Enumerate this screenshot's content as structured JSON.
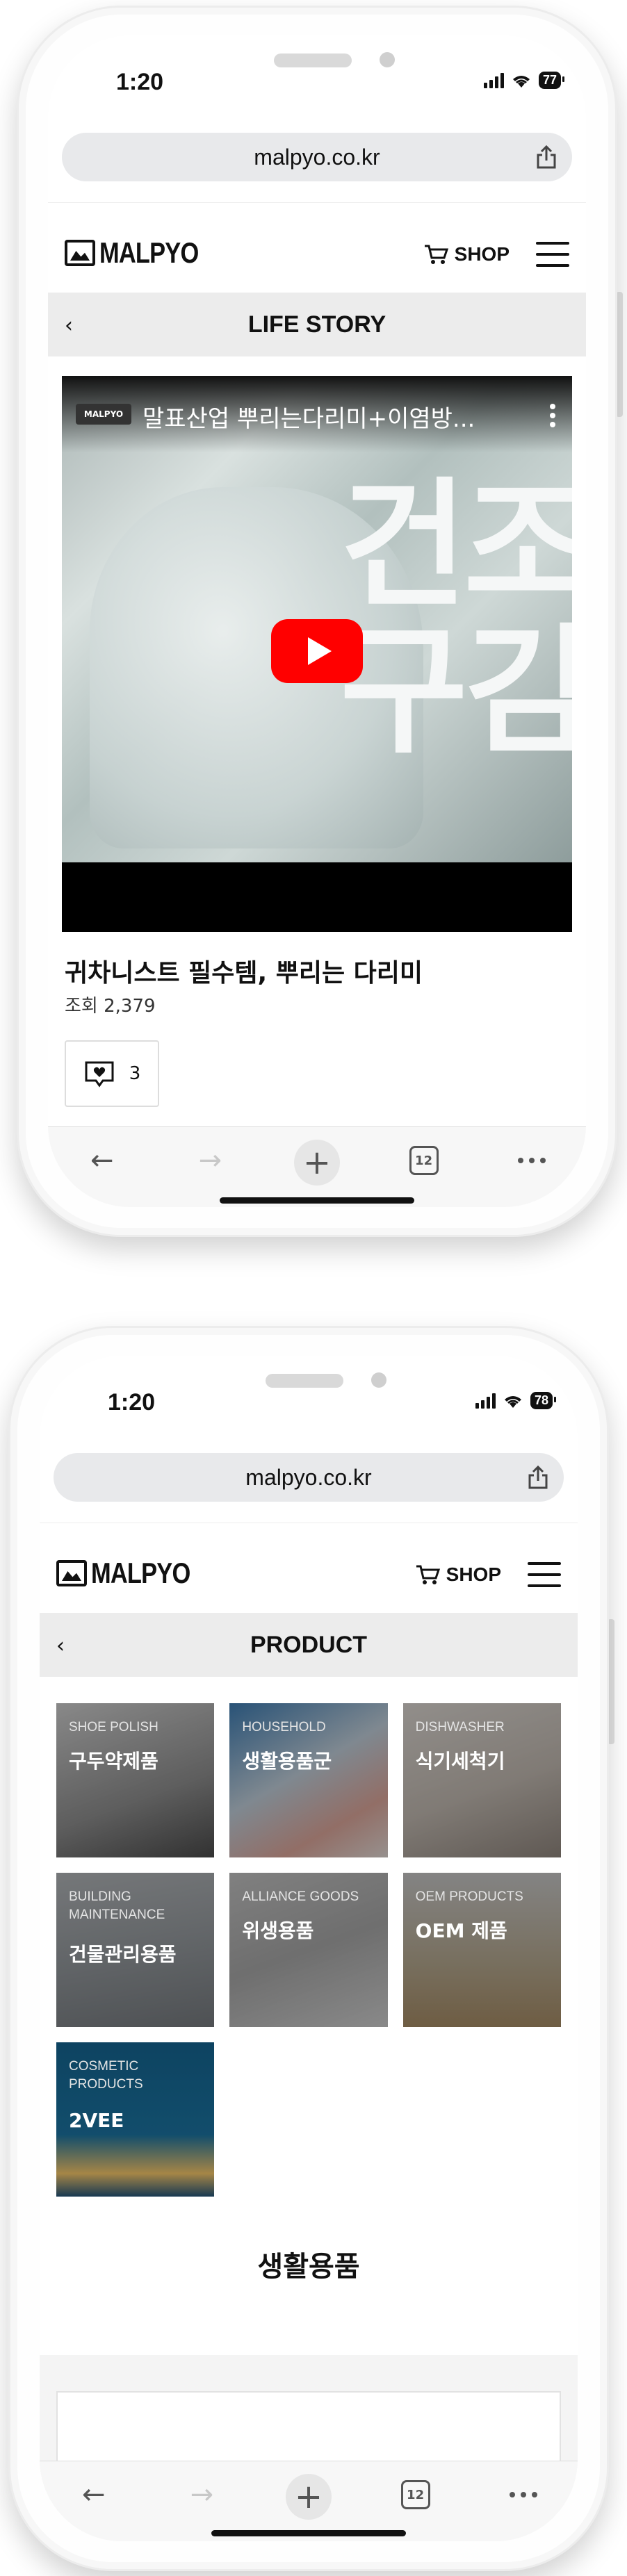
{
  "phone1": {
    "status": {
      "time": "1:20",
      "battery": "77"
    },
    "browser": {
      "url": "malpyo.co.kr"
    },
    "site": {
      "logo": "MALPYO",
      "shop": "SHOP"
    },
    "page": {
      "title": "LIFE STORY"
    },
    "video": {
      "channel": "MALPYO",
      "title": "말표산업 뿌리는다리미+이염방...",
      "overlay_text": "건조\n구김"
    },
    "post": {
      "title": "귀차니스트 필수템, 뿌리는 다리미",
      "views": "조회 2,379",
      "likes": "3"
    },
    "toolbar": {
      "tabs": "12"
    }
  },
  "phone2": {
    "status": {
      "time": "1:20",
      "battery": "78"
    },
    "browser": {
      "url": "malpyo.co.kr"
    },
    "site": {
      "logo": "MALPYO",
      "shop": "SHOP"
    },
    "page": {
      "title": "PRODUCT"
    },
    "categories": [
      {
        "en": "SHOE POLISH",
        "ko": "구두약제품"
      },
      {
        "en": "HOUSEHOLD",
        "ko": "생활용품군"
      },
      {
        "en": "DISHWASHER",
        "ko": "식기세척기"
      },
      {
        "en": "BUILDING MAINTENANCE",
        "ko": "건물관리용품"
      },
      {
        "en": "ALLIANCE GOODS",
        "ko": "위생용품"
      },
      {
        "en": "OEM PRODUCTS",
        "ko": "OEM 제품"
      },
      {
        "en": "COSMETIC PRODUCTS",
        "ko": "2VEE"
      }
    ],
    "section": {
      "heading": "생활용품"
    },
    "toolbar": {
      "tabs": "12"
    }
  },
  "colors": {
    "youtube_red": "#ff0000",
    "subheader_bg": "#ececec",
    "cosmetic_tile": "#0e4d6e"
  }
}
